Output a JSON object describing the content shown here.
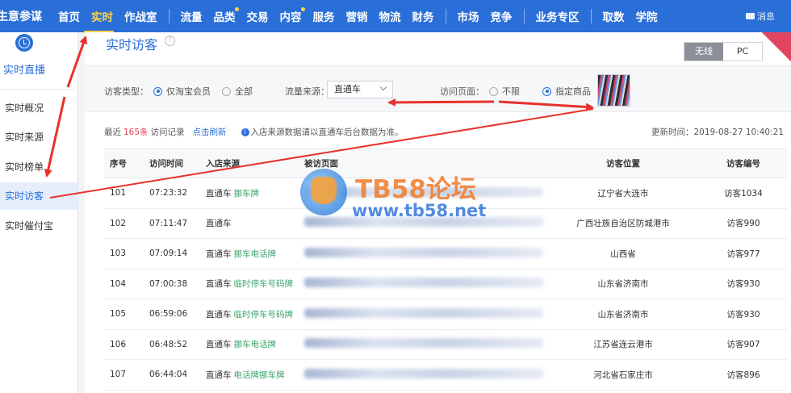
{
  "topnav": {
    "brand": "生意参谋",
    "items": [
      {
        "label": "首页",
        "active": false,
        "dot": false
      },
      {
        "label": "实时",
        "active": true,
        "dot": false
      },
      {
        "label": "作战室",
        "active": false,
        "dot": false
      },
      {
        "label": "流量",
        "active": false,
        "dot": false
      },
      {
        "label": "品类",
        "active": false,
        "dot": true
      },
      {
        "label": "交易",
        "active": false,
        "dot": false
      },
      {
        "label": "内容",
        "active": false,
        "dot": true
      },
      {
        "label": "服务",
        "active": false,
        "dot": false
      },
      {
        "label": "营销",
        "active": false,
        "dot": false
      },
      {
        "label": "物流",
        "active": false,
        "dot": false
      },
      {
        "label": "财务",
        "active": false,
        "dot": false
      },
      {
        "label": "市场",
        "active": false,
        "dot": false
      },
      {
        "label": "竞争",
        "active": false,
        "dot": false
      },
      {
        "label": "业务专区",
        "active": false,
        "dot": false
      },
      {
        "label": "取数",
        "active": false,
        "dot": false
      },
      {
        "label": "学院",
        "active": false,
        "dot": false
      }
    ],
    "message": "消息"
  },
  "sidebar": {
    "title": "实时直播",
    "items": [
      "实时概况",
      "实时来源",
      "实时榜单",
      "实时访客",
      "实时催付宝"
    ],
    "active_index": 3
  },
  "main": {
    "title": "实时访客",
    "help": "?",
    "device_tabs": [
      "无线",
      "PC"
    ],
    "active_device": "无线",
    "filters": {
      "visitor_type_label": "访客类型：",
      "visitor_type_options": [
        "仅淘宝会员",
        "全部"
      ],
      "traffic_source_label": "流量来源：",
      "traffic_source_value": "直通车",
      "visit_page_label": "访问页面：",
      "visit_page_options": [
        "不限",
        "指定商品"
      ]
    },
    "summary": {
      "prefix": "最近",
      "count": "165条",
      "suffix": "访问记录",
      "refresh": "点击刷新",
      "info_icon": "i",
      "notice": "入店来源数据请以直通车后台数据为准。",
      "updated": "更新时间：2019-08-27 10:40:21"
    },
    "table": {
      "headers": [
        "序号",
        "访问时间",
        "入店来源",
        "被访页面",
        "访客位置",
        "访客编号"
      ],
      "rows": [
        {
          "no": "101",
          "time": "07:23:32",
          "source": "直通车",
          "keyword": "挪车牌",
          "location": "辽宁省大连市",
          "visitor": "访客1034"
        },
        {
          "no": "102",
          "time": "07:11:47",
          "source": "直通车",
          "keyword": "",
          "location": "广西壮族自治区防城港市",
          "visitor": "访客990"
        },
        {
          "no": "103",
          "time": "07:09:14",
          "source": "直通车",
          "keyword": "挪车电话牌",
          "location": "山西省",
          "visitor": "访客977"
        },
        {
          "no": "104",
          "time": "07:00:38",
          "source": "直通车",
          "keyword": "临时停车号码牌",
          "location": "山东省济南市",
          "visitor": "访客930"
        },
        {
          "no": "105",
          "time": "06:59:06",
          "source": "直通车",
          "keyword": "临时停车号码牌",
          "location": "山东省济南市",
          "visitor": "访客930"
        },
        {
          "no": "106",
          "time": "06:48:52",
          "source": "直通车",
          "keyword": "挪车电话牌",
          "location": "江苏省连云港市",
          "visitor": "访客907"
        },
        {
          "no": "107",
          "time": "06:44:04",
          "source": "直通车",
          "keyword": "电话牌挪车牌",
          "location": "河北省石家庄市",
          "visitor": "访客896"
        }
      ]
    }
  },
  "watermark": {
    "title": "TB58论坛",
    "url": "www.tb58.net"
  },
  "colors": {
    "nav_bg": "#2a6fd8",
    "nav_active": "#ffd34a",
    "accent": "#2a6fd8",
    "count_red": "#e0455f",
    "keyword_green": "#3ba56c",
    "arrow_red": "#e8312c"
  }
}
